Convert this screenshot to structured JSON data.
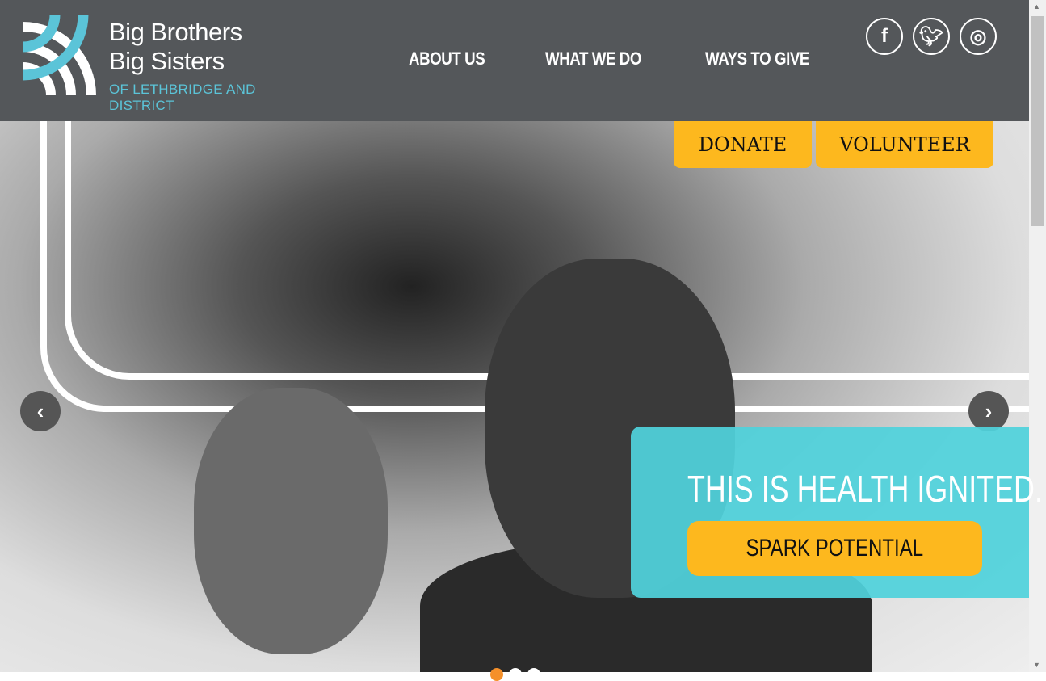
{
  "logo": {
    "line1": "Big Brothers",
    "line2": "Big Sisters",
    "line3": "OF LETHBRIDGE AND DISTRICT"
  },
  "nav": [
    "ABOUT US",
    "WHAT WE DO",
    "WAYS TO GIVE"
  ],
  "social": [
    "facebook-icon",
    "twitter-icon",
    "instagram-icon"
  ],
  "cta": {
    "donate": "DONATE",
    "volunteer": "VOLUNTEER"
  },
  "hero": {
    "headline": "THIS IS HEALTH IGNITED.",
    "button": "SPARK POTENTIAL"
  },
  "colors": {
    "header": "#54575a",
    "accent": "#fdb81e",
    "teal": "#5bc4d8"
  }
}
